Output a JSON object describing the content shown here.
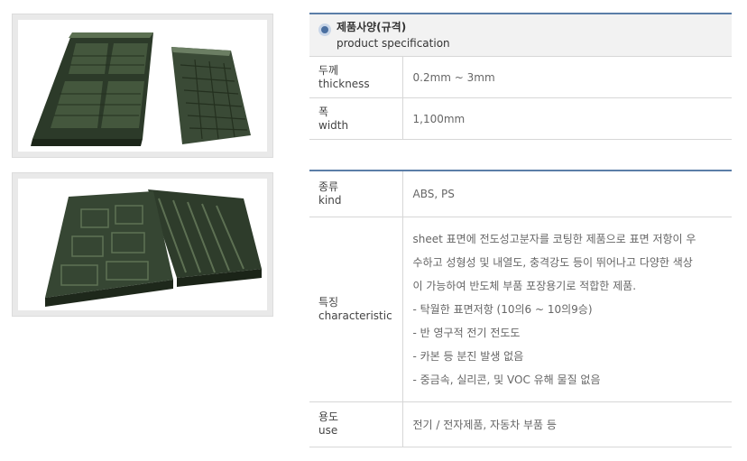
{
  "spec_table": {
    "header_ko": "제품사양(규격)",
    "header_en": "product specification",
    "rows": [
      {
        "label_ko": "두께",
        "label_en": "thickness",
        "value": "0.2mm ~ 3mm"
      },
      {
        "label_ko": "폭",
        "label_en": "width",
        "value": "1,100mm"
      }
    ]
  },
  "detail_table": {
    "kind": {
      "label_ko": "종류",
      "label_en": "kind",
      "value": "ABS, PS"
    },
    "characteristic": {
      "label_ko": "특징",
      "label_en": "characteristic",
      "lines": [
        "sheet 표면에 전도성고분자를 코팅한 제품으로 표면 저항이 우",
        "수하고 성형성 및 내열도, 충격강도 등이 뛰어나고 다양한 색상",
        "이 가능하여 반도체 부품 포장용기로 적합한 제품.",
        "- 탁월한 표면저항 (10의6 ~ 10의9승)",
        "- 반 영구적 전기 전도도",
        "- 카본 등 분진 발생 없음",
        "- 중금속, 실리콘, 및 VOC 유해 물질 없음"
      ]
    },
    "use": {
      "label_ko": "용도",
      "label_en": "use",
      "value": "전기 / 전자제품, 자동차 부품 등"
    }
  },
  "colors": {
    "accent": "#5b7ea8",
    "tray": "#2f3f2c"
  }
}
